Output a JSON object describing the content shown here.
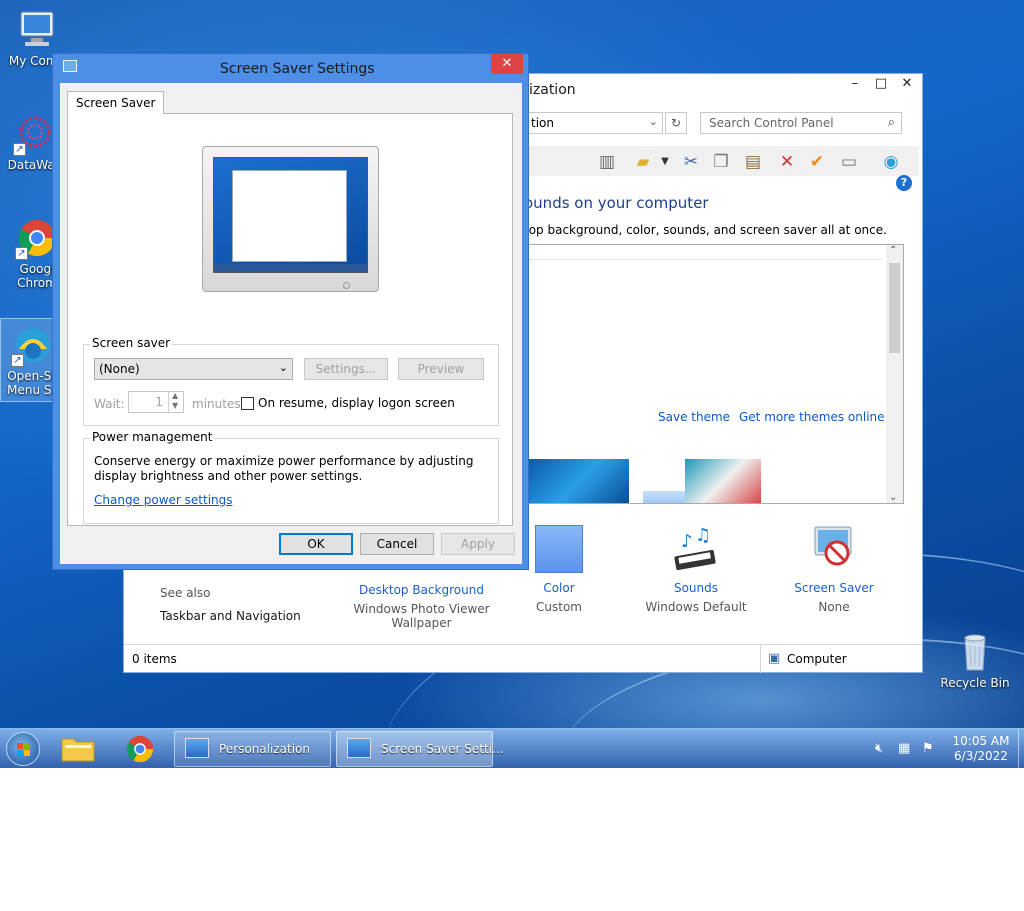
{
  "desktop": {
    "icons": [
      {
        "label": "My Comp",
        "sub": ""
      },
      {
        "label": "DataWag",
        "sub": ""
      },
      {
        "label": "Googl",
        "sub": "Chrom"
      },
      {
        "label": "Open-Sh",
        "sub": "Menu Se"
      },
      {
        "label": "Recycle Bin",
        "sub": ""
      }
    ]
  },
  "personalization": {
    "title": "ization",
    "address": "tion",
    "search_placeholder": "Search Control Panel",
    "heading": "ounds on your computer",
    "subheading": "top background, color, sounds, and screen saver all at once.",
    "save_theme": "Save theme",
    "get_more_themes": "Get more themes online",
    "see_also": "See also",
    "see_also_link": "Taskbar and Navigation",
    "tiles": [
      {
        "label": "Desktop Background",
        "value": "Windows Photo Viewer",
        "value2": "Wallpaper"
      },
      {
        "label": "Color",
        "value": "Custom",
        "value2": ""
      },
      {
        "label": "Sounds",
        "value": "Windows Default",
        "value2": ""
      },
      {
        "label": "Screen Saver",
        "value": "None",
        "value2": ""
      }
    ],
    "status_items": "0 items",
    "status_location": "Computer"
  },
  "dialog": {
    "title": "Screen Saver Settings",
    "tab": "Screen Saver",
    "screensaver_group": "Screen saver",
    "selected": "(None)",
    "settings_btn": "Settings...",
    "preview_btn": "Preview",
    "wait_label": "Wait:",
    "wait_value": "1",
    "minutes_label": "minutes",
    "resume_label": "On resume, display logon screen",
    "power_group": "Power management",
    "power_text": "Conserve energy or maximize power performance by adjusting display brightness and other power settings.",
    "power_link": "Change power settings",
    "ok": "OK",
    "cancel": "Cancel",
    "apply": "Apply"
  },
  "taskbar": {
    "items": [
      {
        "label": "Personalization"
      },
      {
        "label": "Screen Saver Setti..."
      }
    ],
    "time": "10:05 AM",
    "date": "6/3/2022"
  },
  "colors": {
    "accent": "#4d8fe6",
    "link": "#0b57c8",
    "close": "#e04343"
  }
}
